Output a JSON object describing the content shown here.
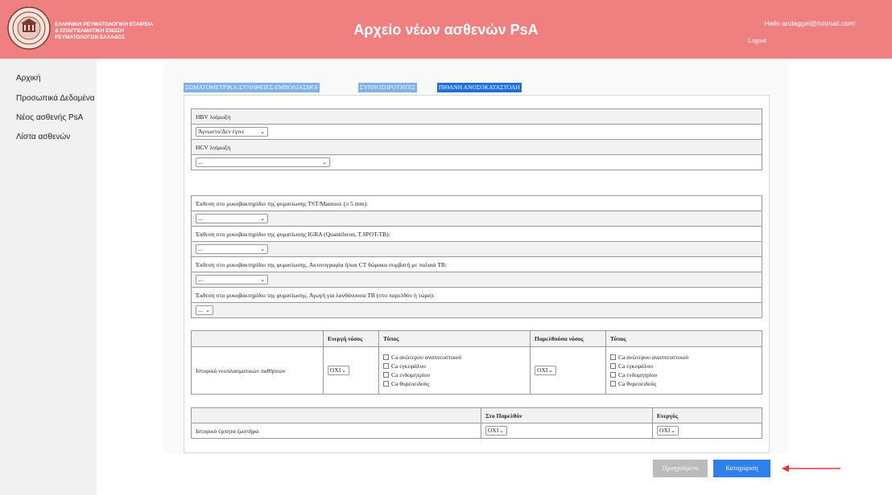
{
  "header": {
    "org_lines": [
      "ΕΛΛΗΝΙΚΗ ΡΕΥΜΑΤΟΛΟΓΙΚΗ ΕΤΑΙΡΕΙΑ",
      "& ΕΠΑΓΓΕΛΜΑΤΙΚΗ ΕΝΩΣΗ",
      "ΡΕΥΜΑΤΟΛΟΓΩΝ ΕΛΛΑΔΟΣ"
    ],
    "title": "Αρχείο νέων ασθενών PsA",
    "greeting": "Hello andaggel@hotmail.com!",
    "logout": "Logout",
    "color": "#f08080"
  },
  "sidebar": {
    "items": [
      {
        "label": "Αρχική"
      },
      {
        "label": "Προσωπικά Δεδομένα"
      },
      {
        "label": "Νέος ασθενής PsA"
      },
      {
        "label": "Λίστα ασθενών"
      }
    ]
  },
  "tabs": [
    {
      "label": "ΣΩΜΑΤΟΜΕΤΡΙΚΑ-ΣΥΝΗΘΕΙΕΣ-ΕΜΒΟΛΙΑΣΜΟΙ",
      "active": false
    },
    {
      "label": "ΣΥΝΝΟΣΗΡΟΤΗΤΕΣ",
      "active": false
    },
    {
      "label": "ΠΙΘΑΝΗ ΑΝΟΣΟΚΑΤΑΣΤΟΛΗ",
      "active": true
    }
  ],
  "hepatitis": {
    "hbv_label": "HBV λοίμωξη",
    "hbv_value": "Άγνωστο/Δεν έγινε",
    "hcv_label": "HCV λοίμωξη",
    "hcv_value": "..."
  },
  "tb": {
    "tst_label": "Έκθεση στο μυκοβακτηρίδιο της φυματίωσης TST/Mantoux (≥ 5 mm):",
    "tst_value": "...",
    "igra_label": "Έκθεση στο μυκοβακτηρίδιο της φυματίωσης IGRA (Quantiferon, T.SPOT-TB):",
    "igra_value": "...",
    "xray_label": "Έκθεση στο μυκοβακτηρίδιο της φυματίωσης. Ακτινογραφία ή/και CT θώρακα συμβατή με παλαιά TB:",
    "xray_value": "...",
    "treatment_label": "Έκθεση στο μυκοβακτηρίδιο της φυματίωσης. Αγωγή για λανθάνουσα TB (στο παρελθόν ή τώρα):",
    "treatment_value": "..."
  },
  "neoplasm": {
    "active_header": "Ενεργή νόσος",
    "type_header": "Τύπος",
    "past_header": "Παρελθούσα νόσος",
    "type_header2": "Τύπος",
    "row_label": "Ιστορικό νεοπλασματικών παθήσεων",
    "active_value": "ΟΧΙ",
    "past_value": "ΟΧΙ",
    "types": [
      "Ca ανώτερου αναπνευστικού",
      "Ca εγκεφάλου",
      "Ca ενδομητρίου",
      "Ca θυρεοειδούς"
    ]
  },
  "zoster": {
    "past_header": "Στο Παρελθόν",
    "active_header": "Ενεργός",
    "row_label": "Ιστορικό έρπητα ζωστήρα",
    "past_value": "ΟΧΙ",
    "active_value": "ΟΧΙ"
  },
  "buttons": {
    "previous": "Προηγούμενο",
    "submit": "Καταχώριση"
  }
}
